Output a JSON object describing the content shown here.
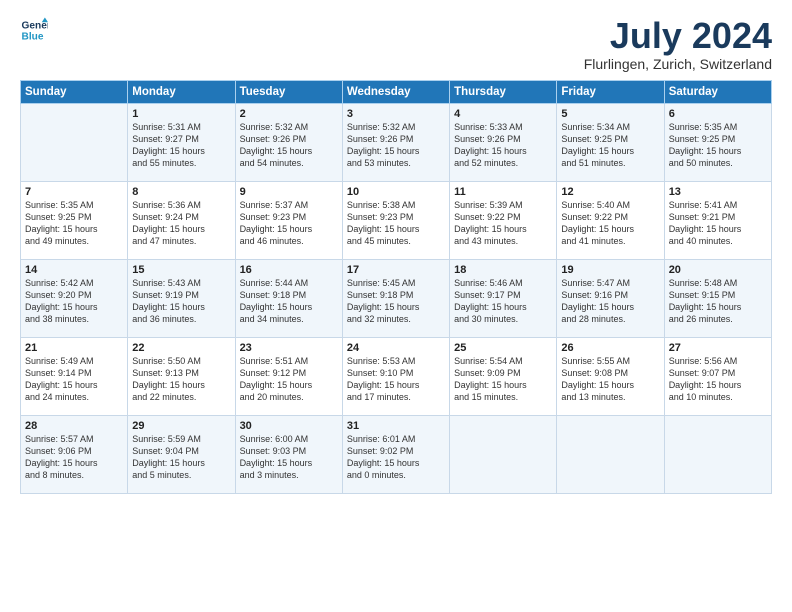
{
  "header": {
    "logo_line1": "General",
    "logo_line2": "Blue",
    "month_title": "July 2024",
    "location": "Flurlingen, Zurich, Switzerland"
  },
  "days_of_week": [
    "Sunday",
    "Monday",
    "Tuesday",
    "Wednesday",
    "Thursday",
    "Friday",
    "Saturday"
  ],
  "weeks": [
    [
      {
        "day": "",
        "text": ""
      },
      {
        "day": "1",
        "text": "Sunrise: 5:31 AM\nSunset: 9:27 PM\nDaylight: 15 hours\nand 55 minutes."
      },
      {
        "day": "2",
        "text": "Sunrise: 5:32 AM\nSunset: 9:26 PM\nDaylight: 15 hours\nand 54 minutes."
      },
      {
        "day": "3",
        "text": "Sunrise: 5:32 AM\nSunset: 9:26 PM\nDaylight: 15 hours\nand 53 minutes."
      },
      {
        "day": "4",
        "text": "Sunrise: 5:33 AM\nSunset: 9:26 PM\nDaylight: 15 hours\nand 52 minutes."
      },
      {
        "day": "5",
        "text": "Sunrise: 5:34 AM\nSunset: 9:25 PM\nDaylight: 15 hours\nand 51 minutes."
      },
      {
        "day": "6",
        "text": "Sunrise: 5:35 AM\nSunset: 9:25 PM\nDaylight: 15 hours\nand 50 minutes."
      }
    ],
    [
      {
        "day": "7",
        "text": "Sunrise: 5:35 AM\nSunset: 9:25 PM\nDaylight: 15 hours\nand 49 minutes."
      },
      {
        "day": "8",
        "text": "Sunrise: 5:36 AM\nSunset: 9:24 PM\nDaylight: 15 hours\nand 47 minutes."
      },
      {
        "day": "9",
        "text": "Sunrise: 5:37 AM\nSunset: 9:23 PM\nDaylight: 15 hours\nand 46 minutes."
      },
      {
        "day": "10",
        "text": "Sunrise: 5:38 AM\nSunset: 9:23 PM\nDaylight: 15 hours\nand 45 minutes."
      },
      {
        "day": "11",
        "text": "Sunrise: 5:39 AM\nSunset: 9:22 PM\nDaylight: 15 hours\nand 43 minutes."
      },
      {
        "day": "12",
        "text": "Sunrise: 5:40 AM\nSunset: 9:22 PM\nDaylight: 15 hours\nand 41 minutes."
      },
      {
        "day": "13",
        "text": "Sunrise: 5:41 AM\nSunset: 9:21 PM\nDaylight: 15 hours\nand 40 minutes."
      }
    ],
    [
      {
        "day": "14",
        "text": "Sunrise: 5:42 AM\nSunset: 9:20 PM\nDaylight: 15 hours\nand 38 minutes."
      },
      {
        "day": "15",
        "text": "Sunrise: 5:43 AM\nSunset: 9:19 PM\nDaylight: 15 hours\nand 36 minutes."
      },
      {
        "day": "16",
        "text": "Sunrise: 5:44 AM\nSunset: 9:18 PM\nDaylight: 15 hours\nand 34 minutes."
      },
      {
        "day": "17",
        "text": "Sunrise: 5:45 AM\nSunset: 9:18 PM\nDaylight: 15 hours\nand 32 minutes."
      },
      {
        "day": "18",
        "text": "Sunrise: 5:46 AM\nSunset: 9:17 PM\nDaylight: 15 hours\nand 30 minutes."
      },
      {
        "day": "19",
        "text": "Sunrise: 5:47 AM\nSunset: 9:16 PM\nDaylight: 15 hours\nand 28 minutes."
      },
      {
        "day": "20",
        "text": "Sunrise: 5:48 AM\nSunset: 9:15 PM\nDaylight: 15 hours\nand 26 minutes."
      }
    ],
    [
      {
        "day": "21",
        "text": "Sunrise: 5:49 AM\nSunset: 9:14 PM\nDaylight: 15 hours\nand 24 minutes."
      },
      {
        "day": "22",
        "text": "Sunrise: 5:50 AM\nSunset: 9:13 PM\nDaylight: 15 hours\nand 22 minutes."
      },
      {
        "day": "23",
        "text": "Sunrise: 5:51 AM\nSunset: 9:12 PM\nDaylight: 15 hours\nand 20 minutes."
      },
      {
        "day": "24",
        "text": "Sunrise: 5:53 AM\nSunset: 9:10 PM\nDaylight: 15 hours\nand 17 minutes."
      },
      {
        "day": "25",
        "text": "Sunrise: 5:54 AM\nSunset: 9:09 PM\nDaylight: 15 hours\nand 15 minutes."
      },
      {
        "day": "26",
        "text": "Sunrise: 5:55 AM\nSunset: 9:08 PM\nDaylight: 15 hours\nand 13 minutes."
      },
      {
        "day": "27",
        "text": "Sunrise: 5:56 AM\nSunset: 9:07 PM\nDaylight: 15 hours\nand 10 minutes."
      }
    ],
    [
      {
        "day": "28",
        "text": "Sunrise: 5:57 AM\nSunset: 9:06 PM\nDaylight: 15 hours\nand 8 minutes."
      },
      {
        "day": "29",
        "text": "Sunrise: 5:59 AM\nSunset: 9:04 PM\nDaylight: 15 hours\nand 5 minutes."
      },
      {
        "day": "30",
        "text": "Sunrise: 6:00 AM\nSunset: 9:03 PM\nDaylight: 15 hours\nand 3 minutes."
      },
      {
        "day": "31",
        "text": "Sunrise: 6:01 AM\nSunset: 9:02 PM\nDaylight: 15 hours\nand 0 minutes."
      },
      {
        "day": "",
        "text": ""
      },
      {
        "day": "",
        "text": ""
      },
      {
        "day": "",
        "text": ""
      }
    ]
  ]
}
